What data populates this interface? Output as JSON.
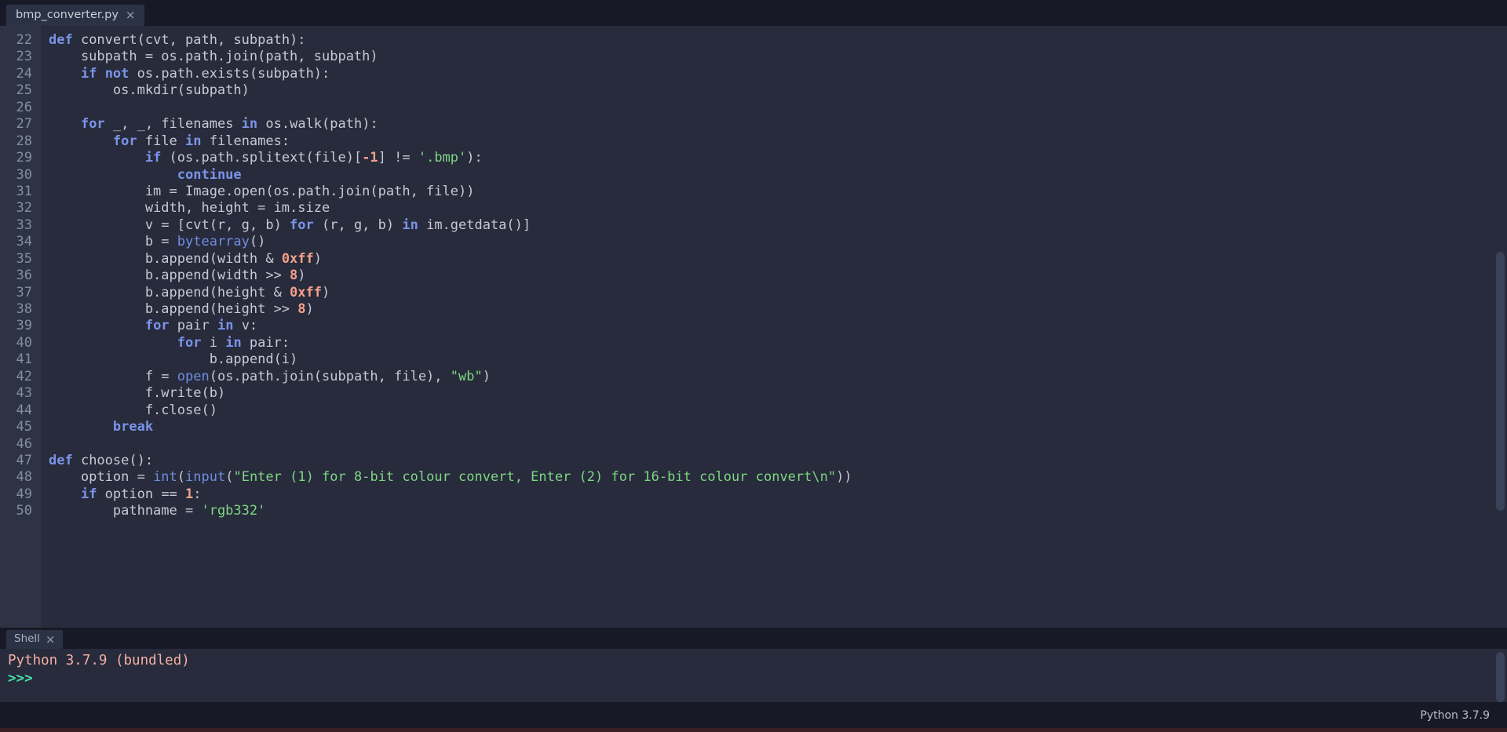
{
  "editor": {
    "tab": {
      "label": "bmp_converter.py",
      "close": "×"
    },
    "first_line_number": 22,
    "lines": [
      {
        "n": 22,
        "tokens": [
          {
            "t": "def ",
            "c": "kw"
          },
          {
            "t": "convert(cvt, path, subpath):",
            "c": "pln"
          }
        ]
      },
      {
        "n": 23,
        "tokens": [
          {
            "t": "    subpath = os.path.join(path, subpath)",
            "c": "pln"
          }
        ]
      },
      {
        "n": 24,
        "tokens": [
          {
            "t": "    ",
            "c": "pln"
          },
          {
            "t": "if",
            "c": "kw"
          },
          {
            "t": " ",
            "c": "pln"
          },
          {
            "t": "not",
            "c": "kw"
          },
          {
            "t": " os.path.exists(subpath):",
            "c": "pln"
          }
        ]
      },
      {
        "n": 25,
        "tokens": [
          {
            "t": "        os.mkdir(subpath)",
            "c": "pln"
          }
        ]
      },
      {
        "n": 26,
        "tokens": [
          {
            "t": "",
            "c": "pln"
          }
        ]
      },
      {
        "n": 27,
        "tokens": [
          {
            "t": "    ",
            "c": "pln"
          },
          {
            "t": "for",
            "c": "kw"
          },
          {
            "t": " _, _, filenames ",
            "c": "pln"
          },
          {
            "t": "in",
            "c": "kw"
          },
          {
            "t": " os.walk(path):",
            "c": "pln"
          }
        ]
      },
      {
        "n": 28,
        "tokens": [
          {
            "t": "        ",
            "c": "pln"
          },
          {
            "t": "for",
            "c": "kw"
          },
          {
            "t": " file ",
            "c": "pln"
          },
          {
            "t": "in",
            "c": "kw"
          },
          {
            "t": " filenames:",
            "c": "pln"
          }
        ]
      },
      {
        "n": 29,
        "tokens": [
          {
            "t": "            ",
            "c": "pln"
          },
          {
            "t": "if",
            "c": "kw"
          },
          {
            "t": " (os.path.splitext(file)[",
            "c": "pln"
          },
          {
            "t": "-1",
            "c": "num"
          },
          {
            "t": "] != ",
            "c": "pln"
          },
          {
            "t": "'.bmp'",
            "c": "str"
          },
          {
            "t": "):",
            "c": "pln"
          }
        ]
      },
      {
        "n": 30,
        "tokens": [
          {
            "t": "                ",
            "c": "pln"
          },
          {
            "t": "continue",
            "c": "kw"
          }
        ]
      },
      {
        "n": 31,
        "tokens": [
          {
            "t": "            im = Image.open(os.path.join(path, file))",
            "c": "pln"
          }
        ]
      },
      {
        "n": 32,
        "tokens": [
          {
            "t": "            width, height = im.size",
            "c": "pln"
          }
        ]
      },
      {
        "n": 33,
        "tokens": [
          {
            "t": "            v = [cvt(r, g, b) ",
            "c": "pln"
          },
          {
            "t": "for",
            "c": "kw"
          },
          {
            "t": " (r, g, b) ",
            "c": "pln"
          },
          {
            "t": "in",
            "c": "kw"
          },
          {
            "t": " im.getdata()]",
            "c": "pln"
          }
        ]
      },
      {
        "n": 34,
        "tokens": [
          {
            "t": "            b = ",
            "c": "pln"
          },
          {
            "t": "bytearray",
            "c": "bi"
          },
          {
            "t": "()",
            "c": "pln"
          }
        ]
      },
      {
        "n": 35,
        "tokens": [
          {
            "t": "            b.append(width & ",
            "c": "pln"
          },
          {
            "t": "0xff",
            "c": "num"
          },
          {
            "t": ")",
            "c": "pln"
          }
        ]
      },
      {
        "n": 36,
        "tokens": [
          {
            "t": "            b.append(width >> ",
            "c": "pln"
          },
          {
            "t": "8",
            "c": "num"
          },
          {
            "t": ")",
            "c": "pln"
          }
        ]
      },
      {
        "n": 37,
        "tokens": [
          {
            "t": "            b.append(height & ",
            "c": "pln"
          },
          {
            "t": "0xff",
            "c": "num"
          },
          {
            "t": ")",
            "c": "pln"
          }
        ]
      },
      {
        "n": 38,
        "tokens": [
          {
            "t": "            b.append(height >> ",
            "c": "pln"
          },
          {
            "t": "8",
            "c": "num"
          },
          {
            "t": ")",
            "c": "pln"
          }
        ]
      },
      {
        "n": 39,
        "tokens": [
          {
            "t": "            ",
            "c": "pln"
          },
          {
            "t": "for",
            "c": "kw"
          },
          {
            "t": " pair ",
            "c": "pln"
          },
          {
            "t": "in",
            "c": "kw"
          },
          {
            "t": " v:",
            "c": "pln"
          }
        ]
      },
      {
        "n": 40,
        "tokens": [
          {
            "t": "                ",
            "c": "pln"
          },
          {
            "t": "for",
            "c": "kw"
          },
          {
            "t": " i ",
            "c": "pln"
          },
          {
            "t": "in",
            "c": "kw"
          },
          {
            "t": " pair:",
            "c": "pln"
          }
        ]
      },
      {
        "n": 41,
        "tokens": [
          {
            "t": "                    b.append(i)",
            "c": "pln"
          }
        ]
      },
      {
        "n": 42,
        "tokens": [
          {
            "t": "            f = ",
            "c": "pln"
          },
          {
            "t": "open",
            "c": "bi"
          },
          {
            "t": "(os.path.join(subpath, file), ",
            "c": "pln"
          },
          {
            "t": "\"wb\"",
            "c": "str"
          },
          {
            "t": ")",
            "c": "pln"
          }
        ]
      },
      {
        "n": 43,
        "tokens": [
          {
            "t": "            f.write(b)",
            "c": "pln"
          }
        ]
      },
      {
        "n": 44,
        "tokens": [
          {
            "t": "            f.close()",
            "c": "pln"
          }
        ]
      },
      {
        "n": 45,
        "tokens": [
          {
            "t": "        ",
            "c": "pln"
          },
          {
            "t": "break",
            "c": "kw"
          }
        ]
      },
      {
        "n": 46,
        "tokens": [
          {
            "t": "",
            "c": "pln"
          }
        ]
      },
      {
        "n": 47,
        "tokens": [
          {
            "t": "def ",
            "c": "kw"
          },
          {
            "t": "choose():",
            "c": "pln"
          }
        ]
      },
      {
        "n": 48,
        "tokens": [
          {
            "t": "    option = ",
            "c": "pln"
          },
          {
            "t": "int",
            "c": "bi"
          },
          {
            "t": "(",
            "c": "pln"
          },
          {
            "t": "input",
            "c": "bi"
          },
          {
            "t": "(",
            "c": "pln"
          },
          {
            "t": "\"Enter (1) for 8-bit colour convert, Enter (2) for 16-bit colour convert\\n\"",
            "c": "str"
          },
          {
            "t": "))",
            "c": "pln"
          }
        ]
      },
      {
        "n": 49,
        "tokens": [
          {
            "t": "    ",
            "c": "pln"
          },
          {
            "t": "if",
            "c": "kw"
          },
          {
            "t": " option == ",
            "c": "pln"
          },
          {
            "t": "1",
            "c": "num"
          },
          {
            "t": ":",
            "c": "pln"
          }
        ]
      },
      {
        "n": 50,
        "tokens": [
          {
            "t": "        pathname = ",
            "c": "pln"
          },
          {
            "t": "'rgb332'",
            "c": "str"
          }
        ]
      }
    ]
  },
  "shell": {
    "tab": {
      "label": "Shell",
      "close": "×"
    },
    "version_line": "Python 3.7.9 (bundled)",
    "prompt": ">>>"
  },
  "statusbar": {
    "interpreter": "Python 3.7.9"
  },
  "colors": {
    "background": "#171a26",
    "editor_background": "#272b3b",
    "gutter_background": "#2d3345",
    "tab_active": "#2b3245",
    "keyword": "#7b93e8",
    "builtin": "#6f8ce0",
    "string": "#7fd684",
    "number": "#f4a08b",
    "plain_text": "#c6cad6",
    "line_number": "#868d9e",
    "shell_version": "#f3b0a4",
    "shell_prompt": "#45e0a8",
    "scrollbar": "#3a4259"
  }
}
